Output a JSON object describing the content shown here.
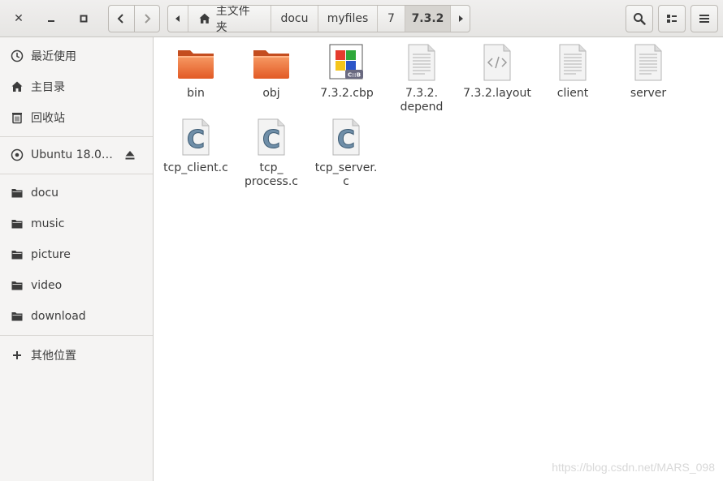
{
  "window_controls": {
    "close": "✕",
    "minimize": "–",
    "maximize": "□"
  },
  "nav": {
    "back_icon": "chevron-left",
    "forward_icon": "chevron-right"
  },
  "path": {
    "home_label": "主文件夹",
    "segments": [
      "docu",
      "myfiles",
      "7",
      "7.3.2"
    ],
    "current": "7.3.2"
  },
  "toolbar": {
    "search_icon": "search",
    "view_icon": "list-view",
    "menu_icon": "hamburger-menu"
  },
  "sidebar": {
    "places": [
      {
        "label": "最近使用",
        "icon": "clock-icon"
      },
      {
        "label": "主目录",
        "icon": "home-icon"
      },
      {
        "label": "回收站",
        "icon": "trash-icon"
      }
    ],
    "device": {
      "label": "Ubuntu 18.0…",
      "icon": "disc-icon"
    },
    "bookmarks": [
      {
        "label": "docu"
      },
      {
        "label": "music"
      },
      {
        "label": "picture"
      },
      {
        "label": "video"
      },
      {
        "label": "download"
      }
    ],
    "other": {
      "label": "其他位置"
    }
  },
  "files": [
    {
      "name": "bin",
      "type": "folder"
    },
    {
      "name": "obj",
      "type": "folder"
    },
    {
      "name": "7.3.2.cbp",
      "type": "codeblocks"
    },
    {
      "name": "7.3.2.\ndepend",
      "type": "text"
    },
    {
      "name": "7.3.2.layout",
      "type": "xml"
    },
    {
      "name": "client",
      "type": "text"
    },
    {
      "name": "server",
      "type": "text"
    },
    {
      "name": "tcp_client.c",
      "type": "c-source"
    },
    {
      "name": "tcp_\nprocess.c",
      "type": "c-source"
    },
    {
      "name": "tcp_server.\nc",
      "type": "c-source"
    }
  ],
  "watermark": "https://blog.csdn.net/MARS_098"
}
